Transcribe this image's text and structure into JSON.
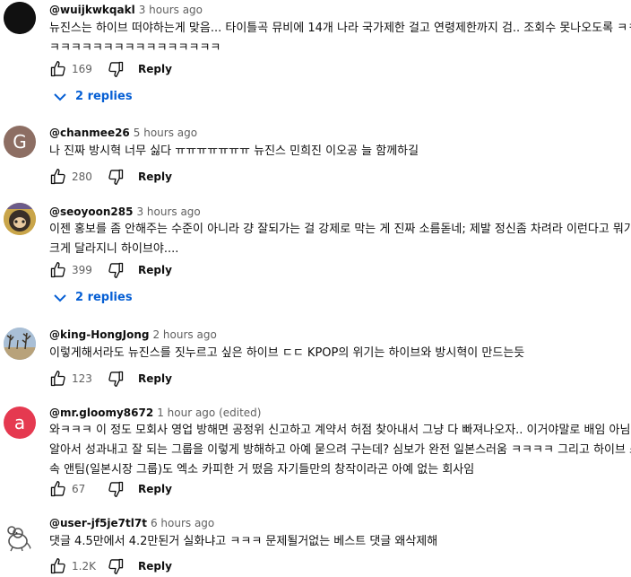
{
  "comments": [
    {
      "handle": "@wuijkwkqakl",
      "time": "3 hours ago",
      "lines": [
        "뉴진스는 하이브 떠야하는게 맞음... 타이틀곡 뮤비에 14개 나라 국가제한 걸고 연령제한까지 검.. 조회수 못나오도록 ㅋㅋ",
        "ㅋㅋㅋㅋㅋㅋㅋㅋㅋㅋㅋㅋㅋㅋㅋㅋ"
      ],
      "likes": "169",
      "reply_label": "Reply",
      "replies_label": "2 replies",
      "avatar": {
        "type": "solid",
        "bg": "#111111"
      }
    },
    {
      "handle": "@chanmee26",
      "time": "5 hours ago",
      "lines": [
        "나 진짜 방시혁 너무 싫다 ㅠㅠㅠㅠㅠㅠㅠ 뉴진스 민희진 이오공 늘 함께하길"
      ],
      "likes": "280",
      "reply_label": "Reply",
      "avatar": {
        "type": "letter",
        "letter": "G",
        "bg": "#8d6e63"
      }
    },
    {
      "handle": "@seoyoon285",
      "time": "3 hours ago",
      "lines": [
        "이젠 홍보를 좀 안해주는 수준이 아니라 걍 잘되가는 걸 강제로 막는 게 진짜 소름돋네; 제발 정신좀 차려라 이런다고 뭐가",
        "크게 달라지니 하이브야...."
      ],
      "likes": "399",
      "reply_label": "Reply",
      "replies_label": "2 replies",
      "avatar": {
        "type": "photo",
        "bg": "#d9b24a"
      }
    },
    {
      "handle": "@king-HongJong",
      "time": "2 hours ago",
      "lines": [
        "이렇게해서라도 뉴진스를 짓누르고 싶은 하이브 ㄷㄷ KPOP의 위기는 하이브와 방시혁이 만드는듯"
      ],
      "likes": "123",
      "reply_label": "Reply",
      "avatar": {
        "type": "landscape",
        "bg": "#9fb3c8"
      }
    },
    {
      "handle": "@mr.gloomy8672",
      "time": "1 hour ago (edited)",
      "lines": [
        "와ㅋㅋㅋ 이 정도 모회사 영업 방해면 공정위 신고하고 계약서 허점 찾아내서 그냥 다 빠져나오자.. 이거야말로 배임 아님..?",
        "알아서 성과내고 잘 되는 그룹을 이렇게 방해하고 아예 묻으려 구는데? 심보가 완전 일본스러움 ㅋㅋㅋㅋ 그리고 하이브 소",
        "속 앤팀(일본시장 그룹)도 엑소 카피한 거 떴음 자기들만의 창작이라곤 아예 없는 회사임"
      ],
      "likes": "67",
      "reply_label": "Reply",
      "avatar": {
        "type": "letter",
        "letter": "a",
        "bg": "#e53950"
      }
    },
    {
      "handle": "@user-jf5je7tl7t",
      "time": "6 hours ago",
      "lines": [
        "댓글 4.5만에서 4.2만된거 실화냐고 ㅋㅋㅋ 문제될거없는 베스트 댓글 왜삭제해"
      ],
      "likes": "1.2K",
      "reply_label": "Reply",
      "avatar": {
        "type": "mouse",
        "bg": "#ffffff"
      }
    }
  ],
  "colors": {
    "link_blue": "#065fd4",
    "meta_gray": "#606060",
    "text": "#0f0f0f"
  },
  "icons": {
    "like": "thumbs-up-icon",
    "dislike": "thumbs-down-icon",
    "expand": "chevron-down-icon"
  }
}
